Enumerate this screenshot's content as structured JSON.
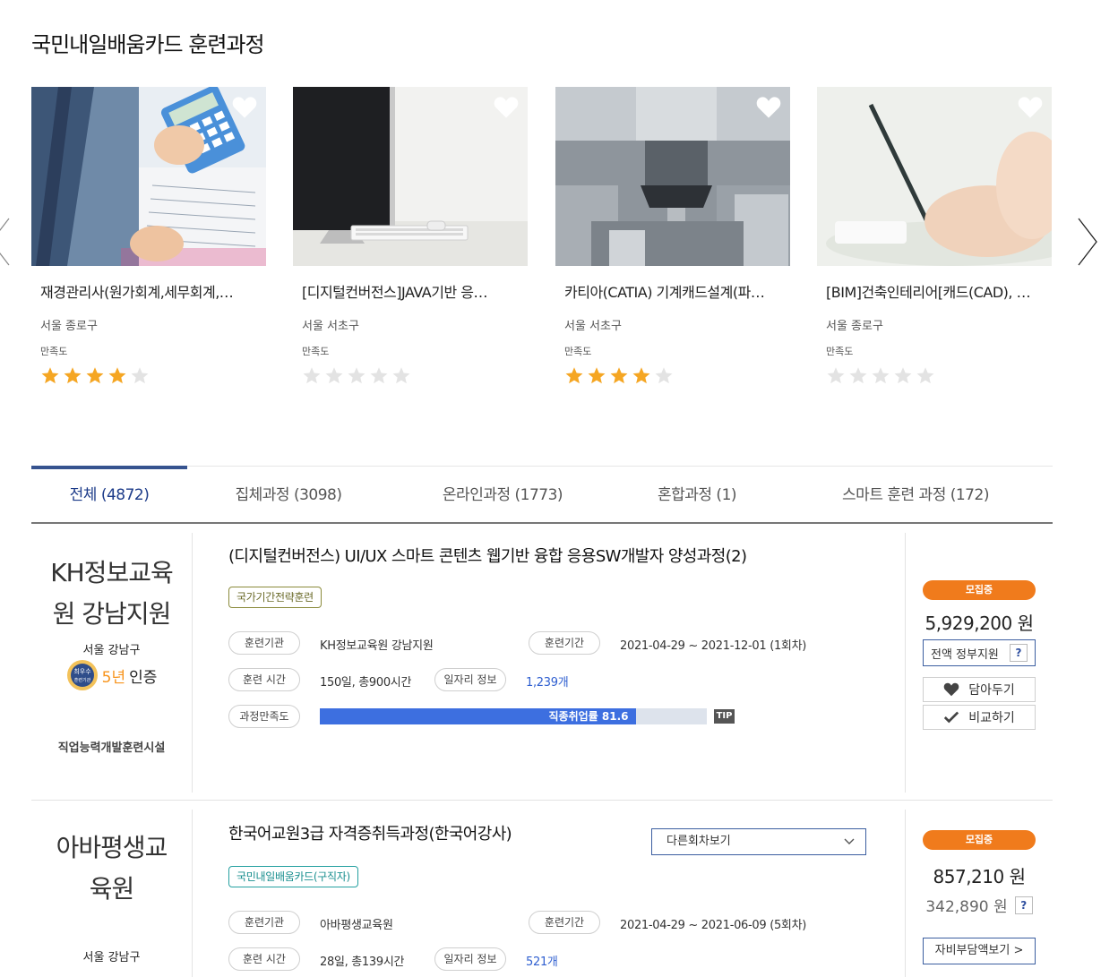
{
  "section": {
    "title": "국민내일배움카드 훈련과정"
  },
  "cards": [
    {
      "title": "재경관리사(원가회계,세무회계,…",
      "location": "서울 종로구",
      "satisfaction_label": "만족도",
      "rating": 4,
      "max_rating": 5,
      "image": "calculator-photo"
    },
    {
      "title": "[디지털컨버전스]JAVA기반 응…",
      "location": "서울 서초구",
      "satisfaction_label": "만족도",
      "rating": 0,
      "max_rating": 5,
      "image": "computer-monitor-photo"
    },
    {
      "title": "카티아(CATIA) 기계캐드설계(파…",
      "location": "서울 서초구",
      "satisfaction_label": "만족도",
      "rating": 4,
      "max_rating": 5,
      "image": "milling-machine-photo"
    },
    {
      "title": "[BIM]건축인테리어[캐드(CAD), …",
      "location": "서울 종로구",
      "satisfaction_label": "만족도",
      "rating": 0,
      "max_rating": 5,
      "image": "pencil-drawing-photo"
    }
  ],
  "tabs": [
    {
      "label": "전체 (4872)",
      "active": true
    },
    {
      "label": "집체과정 (3098)",
      "active": false
    },
    {
      "label": "온라인과정 (1773)",
      "active": false
    },
    {
      "label": "혼합과정 (1)",
      "active": false
    },
    {
      "label": "스마트 훈련 과정 (172)",
      "active": false
    }
  ],
  "courses": [
    {
      "org_name": "KH정보교육원 강남지원",
      "org_location": "서울 강남구",
      "cert_five": "5년",
      "cert_suffix": "인증",
      "cert_badge": "최우수 훈련기관",
      "org_footer": "직업능력개발훈련시설",
      "title": "(디지털컨버전스) UI/UX 스마트 콘텐츠 웹기반 융합 응용SW개발자 양성과정(2)",
      "tag": "국가기간전략훈련",
      "labels": {
        "institution": "훈련기관",
        "period": "훈련기간",
        "hours": "훈련 시간",
        "jobs": "일자리 정보",
        "satisfaction": "과정만족도"
      },
      "institution": "KH정보교육원 강남지원",
      "period": "2021-04-29 ~ 2021-12-01 (1회차)",
      "hours": "150일, 총900시간",
      "jobs": "1,239개",
      "employment_label": "직종취업률 81.6",
      "employment_rate": 81.6,
      "tip": "TIP",
      "status": "모집중",
      "price": "5,929,200 원",
      "gov_label": "전액 정부지원",
      "help": "?",
      "wish_label": "담아두기",
      "compare_label": "비교하기"
    },
    {
      "org_name": "아바평생교육원",
      "org_location": "서울 강남구",
      "title": "한국어교원3급 자격증취득과정(한국어강사)",
      "tag": "국민내일배움카드(구직자)",
      "select_label": "다른회차보기",
      "labels": {
        "institution": "훈련기관",
        "period": "훈련기간",
        "hours": "훈련 시간",
        "jobs": "일자리 정보"
      },
      "institution": "아바평생교육원",
      "period": "2021-04-29 ~ 2021-06-09 (5회차)",
      "hours": "28일, 총139시간",
      "jobs": "521개",
      "status": "모집중",
      "price": "857,210 원",
      "price_self": "342,890 원",
      "help": "?",
      "self_pay_label": "자비부담액보기 >"
    }
  ],
  "colors": {
    "accent": "#1c3b89",
    "status": "#f07b1c",
    "star": "#f5a623",
    "bar": "#3d6fe0"
  }
}
